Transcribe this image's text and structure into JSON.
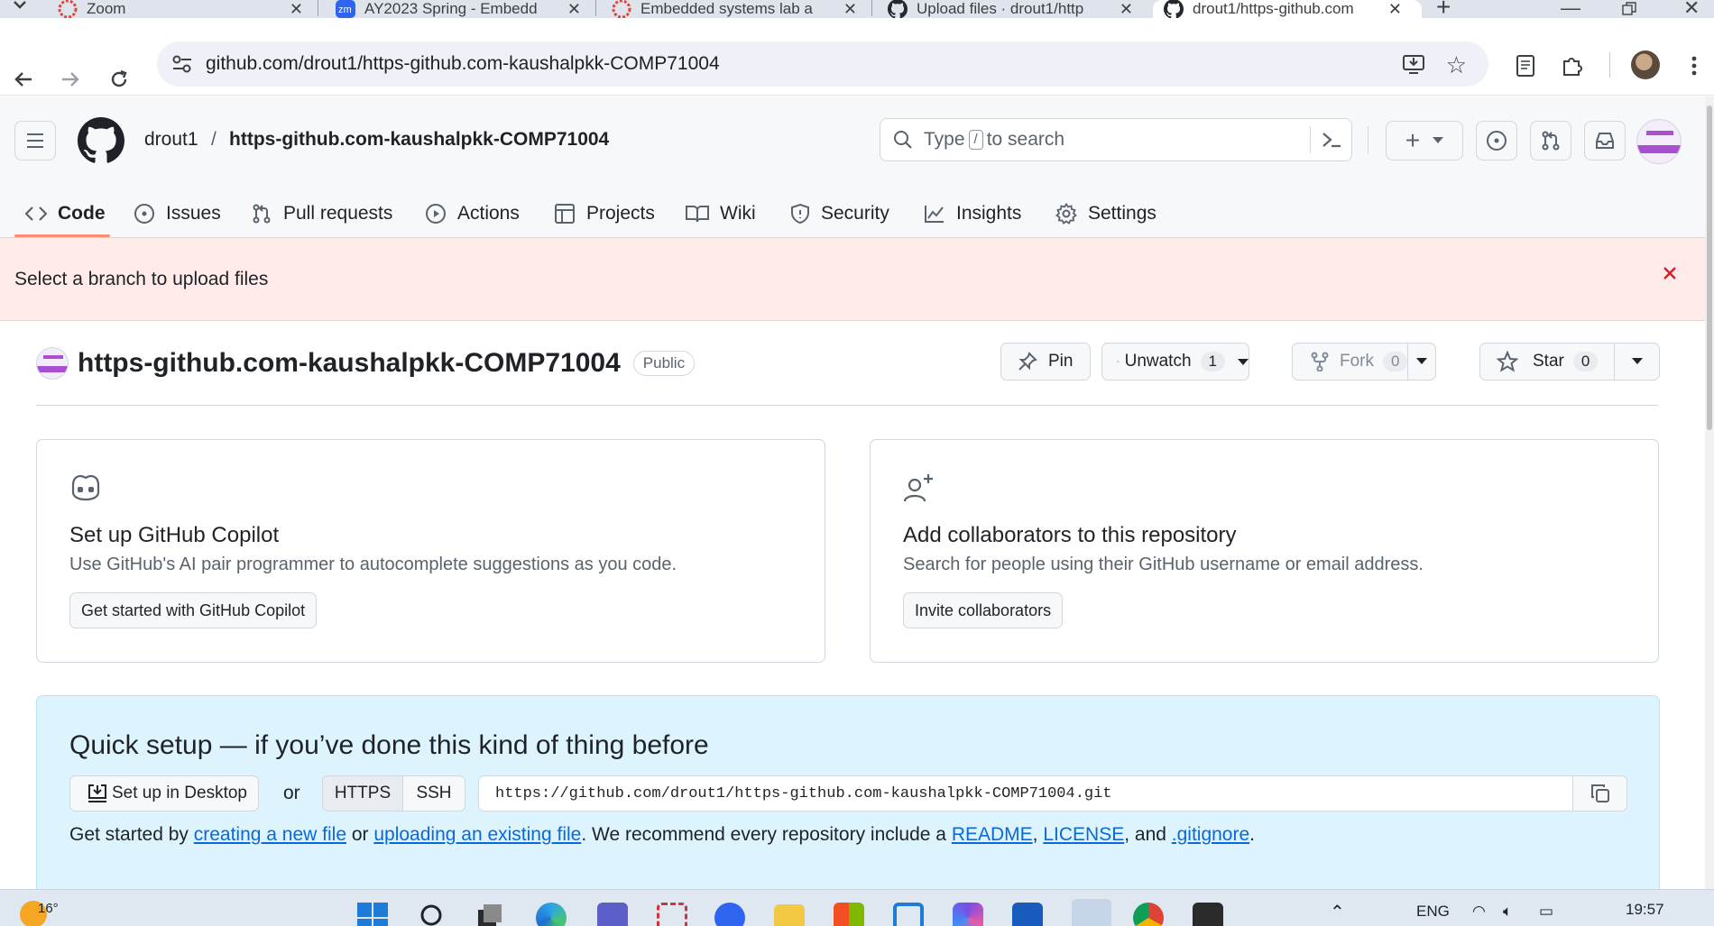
{
  "browser": {
    "tabs": [
      {
        "title": "Zoom",
        "icon": "zoom-alert-icon"
      },
      {
        "title": "AY2023 Spring - Embedd",
        "icon": "zoom-zm-icon"
      },
      {
        "title": "Embedded systems lab a",
        "icon": "zoom-alert-icon"
      },
      {
        "title": "Upload files · drout1/http",
        "icon": "github-icon"
      },
      {
        "title": "drout1/https-github.com",
        "icon": "github-icon",
        "active": true
      }
    ],
    "url": "github.com/drout1/https-github.com-kaushalpkk-COMP71004"
  },
  "header": {
    "owner": "drout1",
    "separator": "/",
    "repo": "https-github.com-kaushalpkk-COMP71004",
    "search_prefix": "Type",
    "search_key": "/",
    "search_suffix": "to search"
  },
  "repo_nav": [
    {
      "label": "Code",
      "icon": "code-icon"
    },
    {
      "label": "Issues",
      "icon": "issue-icon"
    },
    {
      "label": "Pull requests",
      "icon": "pull-request-icon"
    },
    {
      "label": "Actions",
      "icon": "play-icon"
    },
    {
      "label": "Projects",
      "icon": "table-icon"
    },
    {
      "label": "Wiki",
      "icon": "book-icon"
    },
    {
      "label": "Security",
      "icon": "shield-icon"
    },
    {
      "label": "Insights",
      "icon": "graph-icon"
    },
    {
      "label": "Settings",
      "icon": "gear-icon"
    }
  ],
  "flash": {
    "message": "Select a branch to upload files"
  },
  "repo": {
    "name": "https-github.com-kaushalpkk-COMP71004",
    "visibility": "Public",
    "pin_label": "Pin",
    "unwatch_label": "Unwatch",
    "unwatch_count": "1",
    "fork_label": "Fork",
    "fork_count": "0",
    "star_label": "Star",
    "star_count": "0"
  },
  "cards": {
    "copilot": {
      "title": "Set up GitHub Copilot",
      "description": "Use GitHub's AI pair programmer to autocomplete suggestions as you code.",
      "button": "Get started with GitHub Copilot"
    },
    "collaborators": {
      "title": "Add collaborators to this repository",
      "description": "Search for people using their GitHub username or email address.",
      "button": "Invite collaborators"
    }
  },
  "quick_setup": {
    "heading": "Quick setup — if you’ve done this kind of thing before",
    "desktop_button": "Set up in Desktop",
    "or": "or",
    "https": "HTTPS",
    "ssh": "SSH",
    "clone_url": "https://github.com/drout1/https-github.com-kaushalpkk-COMP71004.git",
    "text_1": "Get started by ",
    "link_new": "creating a new file",
    "text_2": " or ",
    "link_upload": "uploading an existing file",
    "text_3": ". We recommend every repository include a ",
    "link_readme": "README",
    "text_4": ", ",
    "link_license": "LICENSE",
    "text_5": ", and ",
    "link_gitignore": ".gitignore",
    "text_6": "."
  },
  "taskbar": {
    "weather": "16°",
    "lang": "ENG",
    "time": "19:57"
  },
  "colors": {
    "flash_bg": "#ffebe9",
    "quick_bg": "#ddf4ff",
    "link": "#0969da",
    "nav_underline": "#fd8c73"
  }
}
